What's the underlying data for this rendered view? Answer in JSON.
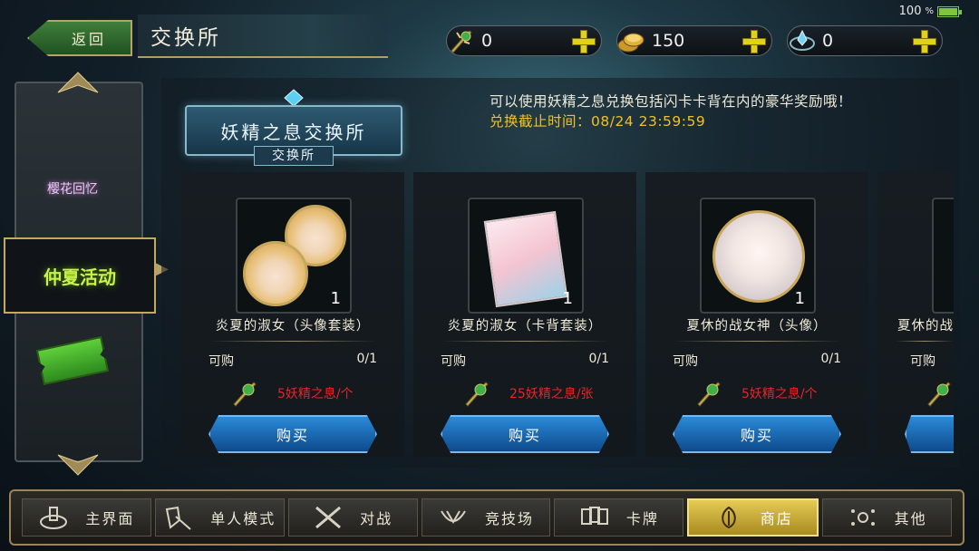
{
  "status": {
    "battery_label": "100",
    "battery_unit": "%",
    "battery_level": 1.0
  },
  "header": {
    "back_label": "返回",
    "title": "交换所"
  },
  "currencies": [
    {
      "name": "fairy-breath",
      "icon": "fairy-breath-icon",
      "value": "0"
    },
    {
      "name": "gold-coin",
      "icon": "gold-coin-icon",
      "value": "150"
    },
    {
      "name": "crystal-orb",
      "icon": "crystal-orb-icon",
      "value": "0"
    }
  ],
  "sidebar": {
    "items": [
      {
        "label": "樱花回忆",
        "icon": "sakura-logo-icon"
      },
      {
        "label": "仲夏活动",
        "icon": "summer-event-icon",
        "selected": true
      },
      {
        "label": "",
        "icon": "ticket-icon"
      }
    ]
  },
  "exchange": {
    "banner_title": "妖精之息交换所",
    "banner_sub": "交换所",
    "notice": "可以使用妖精之息兑换包括闪卡卡背在内的豪华奖励哦！",
    "deadline": "兑换截止时间：08/24 23:59:59"
  },
  "items": [
    {
      "name": "炎夏的淑女（头像套装）",
      "qty": "1",
      "avail_label": "可购",
      "avail_count": "0/1",
      "cost": "5妖精之息/个",
      "buy_label": "购买",
      "thumb": "avatar-set"
    },
    {
      "name": "炎夏的淑女（卡背套装）",
      "qty": "1",
      "avail_label": "可购",
      "avail_count": "0/1",
      "cost": "25妖精之息/张",
      "buy_label": "购买",
      "thumb": "card-back"
    },
    {
      "name": "夏休的战女神（头像）",
      "qty": "1",
      "avail_label": "可购",
      "avail_count": "0/1",
      "cost": "5妖精之息/个",
      "buy_label": "购买",
      "thumb": "avatar-white"
    },
    {
      "name": "夏休的战",
      "qty": "",
      "avail_label": "可购",
      "avail_count": "",
      "cost": "",
      "buy_label": "",
      "thumb": "partial"
    }
  ],
  "bottom_nav": [
    {
      "label": "主界面",
      "icon": "home-icon"
    },
    {
      "label": "单人模式",
      "icon": "single-mode-icon"
    },
    {
      "label": "对战",
      "icon": "crossed-swords-icon"
    },
    {
      "label": "竞技场",
      "icon": "arena-icon"
    },
    {
      "label": "卡牌",
      "icon": "cards-icon"
    },
    {
      "label": "商店",
      "icon": "shop-icon",
      "active": true
    },
    {
      "label": "其他",
      "icon": "other-icon"
    }
  ],
  "colors": {
    "accent_gold": "#c8a75a",
    "buy_blue": "#1f6ab6",
    "cost_red": "#e3262a",
    "deadline_yellow": "#f2c025",
    "selected_green": "#c6f24b"
  }
}
